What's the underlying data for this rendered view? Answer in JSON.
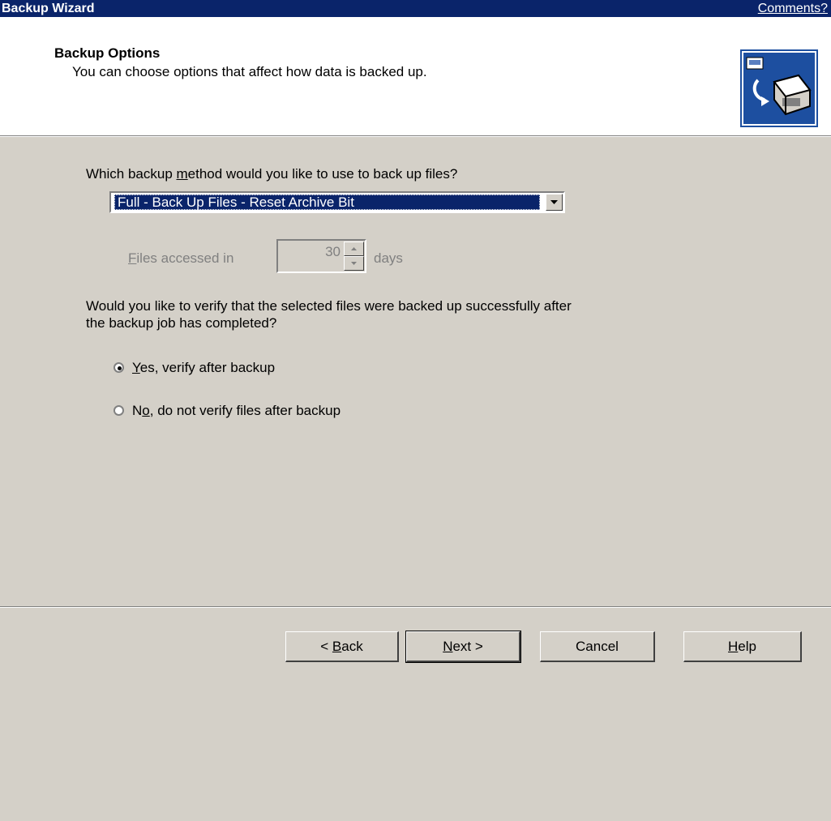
{
  "window": {
    "title": "Backup Wizard",
    "comments_link": "Comments?"
  },
  "header": {
    "title": "Backup Options",
    "subtitle": "You can choose options that affect how data is backed up.",
    "icon": "backup-computer-icon"
  },
  "method": {
    "question_before": "Which backup ",
    "question_accel": "m",
    "question_after": "ethod would you like to use to back up files?",
    "selected": "Full - Back Up Files - Reset Archive Bit"
  },
  "files_accessed": {
    "label_accel": "F",
    "label_rest": "iles accessed in",
    "value": "30",
    "unit": "days",
    "enabled": false
  },
  "verify": {
    "question_line1": "Would you like to verify that the selected files were backed up successfully after",
    "question_line2": "the backup job has completed?",
    "options": [
      {
        "accel": "Y",
        "rest": "es, verify after backup",
        "selected": true
      },
      {
        "pre": "N",
        "accel": "o",
        "rest": ", do not verify files after backup",
        "selected": false
      }
    ]
  },
  "buttons": {
    "back_pre": "< ",
    "back_accel": "B",
    "back_rest": "ack",
    "next_accel": "N",
    "next_rest": "ext >",
    "cancel": "Cancel",
    "help_accel": "H",
    "help_rest": "elp"
  },
  "colors": {
    "titlebar": "#0a246a",
    "dialog": "#d4d0c8",
    "header_bg": "#ffffff",
    "selection": "#0a246a"
  }
}
